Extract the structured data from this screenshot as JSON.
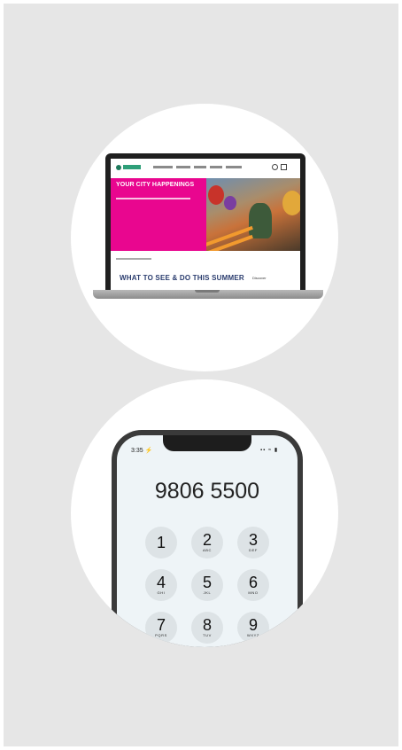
{
  "laptop": {
    "hero_title": "YOUR CITY HAPPENINGS",
    "section_title": "WHAT TO SEE & DO THIS SUMMER",
    "discover_label": "Discover"
  },
  "phone": {
    "status_time": "3:35 ⚡",
    "status_icons": "▪▪ ≈ ▮",
    "dialed_number": "9806 5500",
    "keys": [
      {
        "digit": "1",
        "letters": ""
      },
      {
        "digit": "2",
        "letters": "ABC"
      },
      {
        "digit": "3",
        "letters": "DEF"
      },
      {
        "digit": "4",
        "letters": "GHI"
      },
      {
        "digit": "5",
        "letters": "JKL"
      },
      {
        "digit": "6",
        "letters": "MNO"
      },
      {
        "digit": "7",
        "letters": "PQRS"
      },
      {
        "digit": "8",
        "letters": "TUV"
      },
      {
        "digit": "9",
        "letters": "WXYZ"
      }
    ]
  },
  "colors": {
    "panel_bg": "#e6e6e6",
    "hero_pink": "#e9068f",
    "section_title": "#2a3c6e"
  }
}
